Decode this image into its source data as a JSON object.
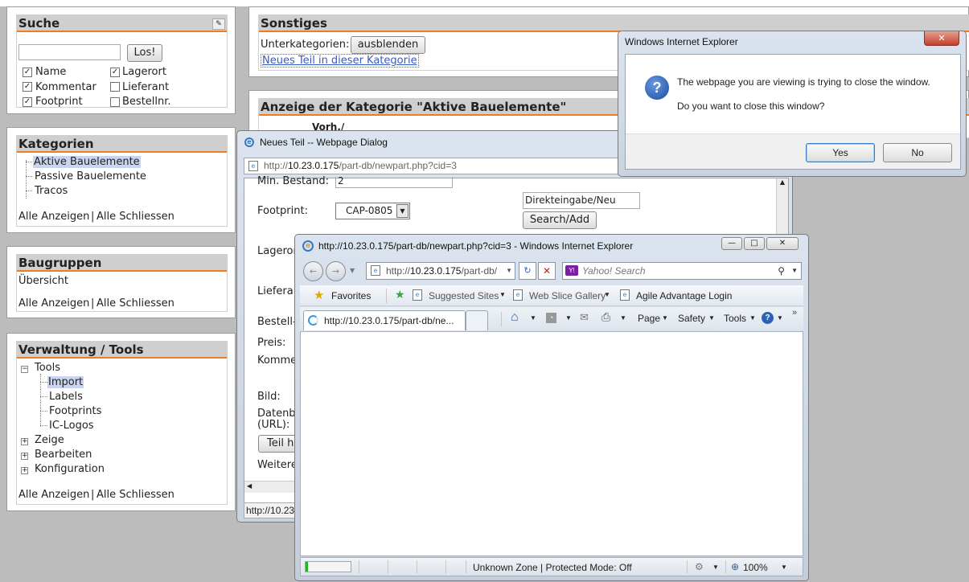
{
  "search": {
    "header": "Suche",
    "input_value": "",
    "button": "Los!",
    "checkboxes": [
      {
        "label": "Name",
        "checked": true
      },
      {
        "label": "Lagerort",
        "checked": true
      },
      {
        "label": "Kommentar",
        "checked": true
      },
      {
        "label": "Lieferant",
        "checked": false
      },
      {
        "label": "Footprint",
        "checked": true
      },
      {
        "label": "Bestellnr.",
        "checked": false
      }
    ]
  },
  "categories": {
    "header": "Kategorien",
    "items": [
      "Aktive Bauelemente",
      "Passive Bauelemente",
      "Tracos"
    ],
    "show_all": "Alle Anzeigen",
    "close_all": "Alle Schliessen",
    "divider": "|"
  },
  "assemblies": {
    "header": "Baugruppen",
    "overview": "Übersicht",
    "show_all": "Alle Anzeigen",
    "close_all": "Alle Schliessen",
    "divider": "|"
  },
  "admin": {
    "header": "Verwaltung / Tools",
    "tools": "Tools",
    "tool_items": [
      "Import",
      "Labels",
      "Footprints",
      "IC-Logos"
    ],
    "other_nodes": [
      "Zeige",
      "Bearbeiten",
      "Konfiguration"
    ],
    "show_all": "Alle Anzeigen",
    "close_all": "Alle Schliessen",
    "divider": "|"
  },
  "misc": {
    "header": "Sonstiges",
    "subcat_label": "Unterkategorien:",
    "hide_button": "ausblenden",
    "new_part_link": "Neues Teil in dieser Kategorie"
  },
  "category_display": {
    "header": "Anzeige der Kategorie \"Aktive Bauelemente\"",
    "col_partial": "Vorh./"
  },
  "dialog": {
    "title": "Neues Teil -- Webpage Dialog",
    "address_prefix": "http://",
    "address_host": "10.23.0.175",
    "address_path": "/part-db/newpart.php?cid=3",
    "min_stock_label": "Min. Bestand:",
    "min_stock_value": "2",
    "footprint_label": "Footprint:",
    "footprint_value": "CAP-0805",
    "direct_input_value": "Direkteingabe/Neu",
    "search_add_button": "Search/Add",
    "storage_label": "Lageror",
    "supplier_label": "Lieferan",
    "order_label": "Bestell-",
    "price_label": "Preis:",
    "comment_label": "Komme",
    "image_label": "Bild:",
    "datasheet_label": "Datenb",
    "datasheet_url_label": "(URL):",
    "add_part_button": "Teil hi",
    "more_label": "Weitere",
    "status_text": "http://10.23"
  },
  "ie": {
    "title": "http://10.23.0.175/part-db/newpart.php?cid=3 - Windows Internet Explorer",
    "address_prefix": "http://",
    "address_host": "10.23.0.175",
    "address_path": "/part-db/",
    "search_placeholder": "Yahoo! Search",
    "favorites": "Favorites",
    "suggested_sites": "Suggested Sites",
    "web_slice_gallery": "Web Slice Gallery",
    "agile_login": "Agile Advantage Login",
    "tab_label": "http://10.23.0.175/part-db/ne...",
    "page_menu": "Page",
    "safety_menu": "Safety",
    "tools_menu": "Tools",
    "status_zone": "Unknown Zone | Protected Mode: Off",
    "zoom": "100%",
    "progress": 0.05
  },
  "confirm": {
    "title": "Windows Internet Explorer",
    "line1": "The webpage you are viewing is trying to close the window.",
    "line2": "Do you want to close this window?",
    "yes": "Yes",
    "no": "No"
  },
  "colors": {
    "accent": "#f07c1e",
    "header_bg": "#cfcfcf",
    "selection": "#c8d4f0",
    "page_bg": "#bcbcbc"
  }
}
